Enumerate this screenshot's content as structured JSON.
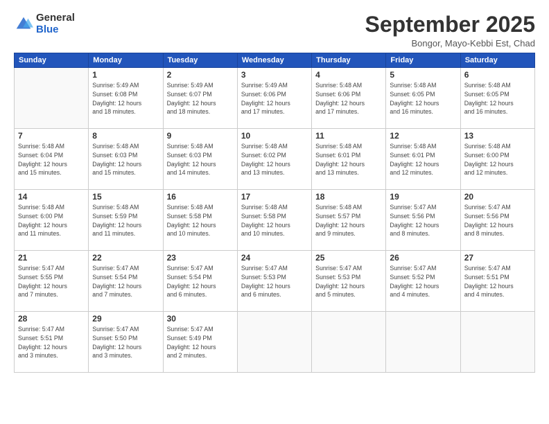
{
  "header": {
    "logo_general": "General",
    "logo_blue": "Blue",
    "month_title": "September 2025",
    "location": "Bongor, Mayo-Kebbi Est, Chad"
  },
  "days_of_week": [
    "Sunday",
    "Monday",
    "Tuesday",
    "Wednesday",
    "Thursday",
    "Friday",
    "Saturday"
  ],
  "weeks": [
    [
      {
        "day": "",
        "detail": ""
      },
      {
        "day": "1",
        "detail": "Sunrise: 5:49 AM\nSunset: 6:08 PM\nDaylight: 12 hours\nand 18 minutes."
      },
      {
        "day": "2",
        "detail": "Sunrise: 5:49 AM\nSunset: 6:07 PM\nDaylight: 12 hours\nand 18 minutes."
      },
      {
        "day": "3",
        "detail": "Sunrise: 5:49 AM\nSunset: 6:06 PM\nDaylight: 12 hours\nand 17 minutes."
      },
      {
        "day": "4",
        "detail": "Sunrise: 5:48 AM\nSunset: 6:06 PM\nDaylight: 12 hours\nand 17 minutes."
      },
      {
        "day": "5",
        "detail": "Sunrise: 5:48 AM\nSunset: 6:05 PM\nDaylight: 12 hours\nand 16 minutes."
      },
      {
        "day": "6",
        "detail": "Sunrise: 5:48 AM\nSunset: 6:05 PM\nDaylight: 12 hours\nand 16 minutes."
      }
    ],
    [
      {
        "day": "7",
        "detail": "Sunrise: 5:48 AM\nSunset: 6:04 PM\nDaylight: 12 hours\nand 15 minutes."
      },
      {
        "day": "8",
        "detail": "Sunrise: 5:48 AM\nSunset: 6:03 PM\nDaylight: 12 hours\nand 15 minutes."
      },
      {
        "day": "9",
        "detail": "Sunrise: 5:48 AM\nSunset: 6:03 PM\nDaylight: 12 hours\nand 14 minutes."
      },
      {
        "day": "10",
        "detail": "Sunrise: 5:48 AM\nSunset: 6:02 PM\nDaylight: 12 hours\nand 13 minutes."
      },
      {
        "day": "11",
        "detail": "Sunrise: 5:48 AM\nSunset: 6:01 PM\nDaylight: 12 hours\nand 13 minutes."
      },
      {
        "day": "12",
        "detail": "Sunrise: 5:48 AM\nSunset: 6:01 PM\nDaylight: 12 hours\nand 12 minutes."
      },
      {
        "day": "13",
        "detail": "Sunrise: 5:48 AM\nSunset: 6:00 PM\nDaylight: 12 hours\nand 12 minutes."
      }
    ],
    [
      {
        "day": "14",
        "detail": "Sunrise: 5:48 AM\nSunset: 6:00 PM\nDaylight: 12 hours\nand 11 minutes."
      },
      {
        "day": "15",
        "detail": "Sunrise: 5:48 AM\nSunset: 5:59 PM\nDaylight: 12 hours\nand 11 minutes."
      },
      {
        "day": "16",
        "detail": "Sunrise: 5:48 AM\nSunset: 5:58 PM\nDaylight: 12 hours\nand 10 minutes."
      },
      {
        "day": "17",
        "detail": "Sunrise: 5:48 AM\nSunset: 5:58 PM\nDaylight: 12 hours\nand 10 minutes."
      },
      {
        "day": "18",
        "detail": "Sunrise: 5:48 AM\nSunset: 5:57 PM\nDaylight: 12 hours\nand 9 minutes."
      },
      {
        "day": "19",
        "detail": "Sunrise: 5:47 AM\nSunset: 5:56 PM\nDaylight: 12 hours\nand 8 minutes."
      },
      {
        "day": "20",
        "detail": "Sunrise: 5:47 AM\nSunset: 5:56 PM\nDaylight: 12 hours\nand 8 minutes."
      }
    ],
    [
      {
        "day": "21",
        "detail": "Sunrise: 5:47 AM\nSunset: 5:55 PM\nDaylight: 12 hours\nand 7 minutes."
      },
      {
        "day": "22",
        "detail": "Sunrise: 5:47 AM\nSunset: 5:54 PM\nDaylight: 12 hours\nand 7 minutes."
      },
      {
        "day": "23",
        "detail": "Sunrise: 5:47 AM\nSunset: 5:54 PM\nDaylight: 12 hours\nand 6 minutes."
      },
      {
        "day": "24",
        "detail": "Sunrise: 5:47 AM\nSunset: 5:53 PM\nDaylight: 12 hours\nand 6 minutes."
      },
      {
        "day": "25",
        "detail": "Sunrise: 5:47 AM\nSunset: 5:53 PM\nDaylight: 12 hours\nand 5 minutes."
      },
      {
        "day": "26",
        "detail": "Sunrise: 5:47 AM\nSunset: 5:52 PM\nDaylight: 12 hours\nand 4 minutes."
      },
      {
        "day": "27",
        "detail": "Sunrise: 5:47 AM\nSunset: 5:51 PM\nDaylight: 12 hours\nand 4 minutes."
      }
    ],
    [
      {
        "day": "28",
        "detail": "Sunrise: 5:47 AM\nSunset: 5:51 PM\nDaylight: 12 hours\nand 3 minutes."
      },
      {
        "day": "29",
        "detail": "Sunrise: 5:47 AM\nSunset: 5:50 PM\nDaylight: 12 hours\nand 3 minutes."
      },
      {
        "day": "30",
        "detail": "Sunrise: 5:47 AM\nSunset: 5:49 PM\nDaylight: 12 hours\nand 2 minutes."
      },
      {
        "day": "",
        "detail": ""
      },
      {
        "day": "",
        "detail": ""
      },
      {
        "day": "",
        "detail": ""
      },
      {
        "day": "",
        "detail": ""
      }
    ]
  ]
}
